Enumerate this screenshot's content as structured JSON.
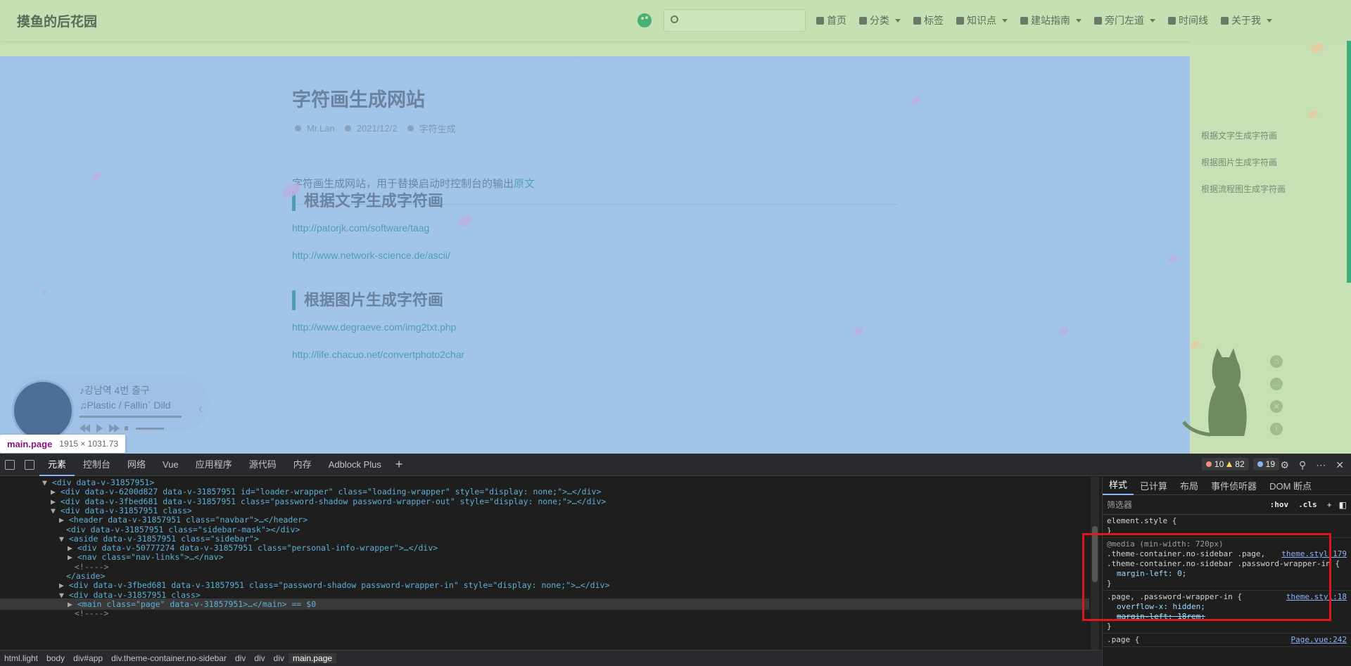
{
  "site": {
    "brand": "摸鱼的后花园",
    "search_placeholder": "",
    "nav": [
      {
        "label": "首页",
        "dropdown": false
      },
      {
        "label": "分类",
        "dropdown": true
      },
      {
        "label": "标签",
        "dropdown": false
      },
      {
        "label": "知识点",
        "dropdown": true
      },
      {
        "label": "建站指南",
        "dropdown": true
      },
      {
        "label": "旁门左道",
        "dropdown": true
      },
      {
        "label": "时间线",
        "dropdown": false
      },
      {
        "label": "关于我",
        "dropdown": true
      }
    ]
  },
  "article": {
    "title": "字符画生成网站",
    "author": "Mr.Lan",
    "date": "2021/12/2",
    "tag": "字符生成",
    "intro": "字符画生成网站，用于替换启动时控制台的输出",
    "intro_link": "原文",
    "section1_title": "根据文字生成字符画",
    "section1_links": [
      "http://patorjk.com/software/taag",
      "http://www.network-science.de/ascii/"
    ],
    "section2_title": "根据图片生成字符画",
    "section2_links": [
      "http://www.degraeve.com/img2txt.php",
      "http://life.chacuo.net/convertphoto2char"
    ]
  },
  "toc": [
    "根据文字生成字符画",
    "根据图片生成字符画",
    "根据流程图生成字符画"
  ],
  "player": {
    "song": "♪강남역 4번 출구",
    "artist": "♫Plastic / Fallin` Dild"
  },
  "tooltip": {
    "selector": "main.page",
    "size": "1915 × 1031.73"
  },
  "devtools": {
    "tabs": [
      "元素",
      "控制台",
      "网络",
      "Vue",
      "应用程序",
      "源代码",
      "内存",
      "Adblock Plus"
    ],
    "errors": "10",
    "warnings": "82",
    "info": "19",
    "breadcrumbs": [
      "html.light",
      "body",
      "div#app",
      "div.theme-container.no-sidebar",
      "div",
      "div",
      "div",
      "main.page"
    ],
    "styles_tabs": [
      "样式",
      "已计算",
      "布局",
      "事件侦听器",
      "DOM 断点"
    ],
    "filter_placeholder": "筛选器",
    "hov": ":hov",
    "cls": ".cls",
    "dom_lines": [
      "<div data-v-31857951>",
      "<div data-v-6200d827 data-v-31857951 id=\"loader-wrapper\" class=\"loading-wrapper\" style=\"display: none;\">…</div>",
      "<div data-v-3fbed681 data-v-31857951 class=\"password-shadow password-wrapper-out\" style=\"display: none;\">…</div>",
      "<div data-v-31857951 class>",
      "<header data-v-31857951 class=\"navbar\">…</header>",
      "<div data-v-31857951 class=\"sidebar-mask\"></div>",
      "<aside data-v-31857951 class=\"sidebar\">",
      "<div data-v-50777274 data-v-31857951 class=\"personal-info-wrapper\">…</div>",
      "<nav class=\"nav-links\">…</nav>",
      "<!---->",
      "</aside>",
      "<div data-v-3fbed681 data-v-31857951 class=\"password-shadow password-wrapper-in\" style=\"display: none;\">…</div>",
      "<div data-v-31857951 class>",
      "<main class=\"page\" data-v-31857951>…</main> == $0",
      "<!---->"
    ],
    "rules": {
      "element_style": "element.style {",
      "media": "@media (min-width: 720px)",
      "media_selector": ".theme-container.no-sidebar .page, .theme-container.no-sidebar .password-wrapper-in {",
      "media_src": "theme.styl:179",
      "media_prop": "margin-left: 0;",
      "rule2_selector": ".page, .password-wrapper-in {",
      "rule2_src": "theme.styl:18",
      "rule2_prop1": "overflow-x: hidden;",
      "rule2_prop2": "margin-left: 18rem;",
      "rule3_selector": ".page {",
      "rule3_src": "Page.vue:242"
    }
  }
}
